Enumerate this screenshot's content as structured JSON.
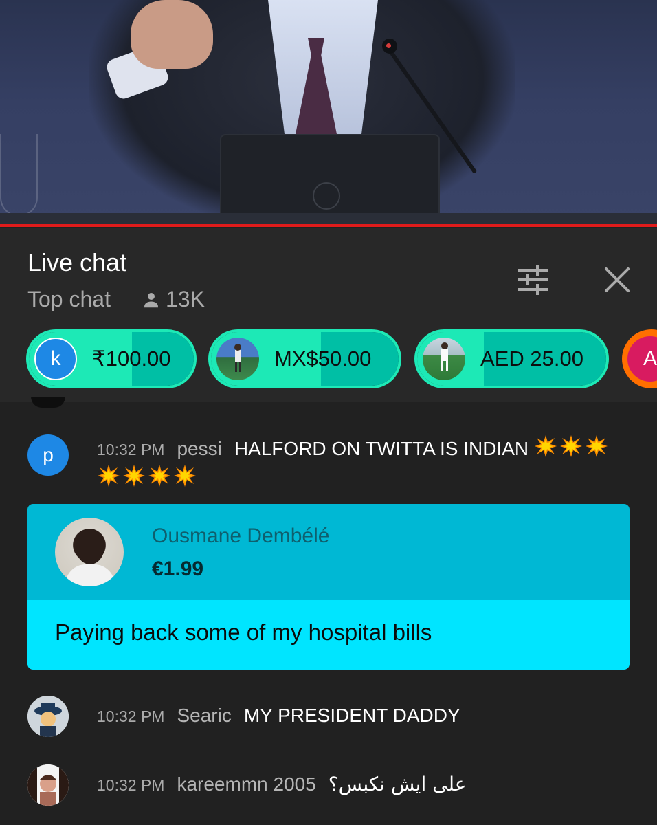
{
  "header": {
    "title": "Live chat",
    "mode": "Top chat",
    "viewer_count": "13K"
  },
  "ticker": [
    {
      "avatar_letter": "k",
      "amount": "₹100.00"
    },
    {
      "avatar_letter": "",
      "amount": "MX$50.00"
    },
    {
      "avatar_letter": "",
      "amount": "AED 25.00"
    },
    {
      "avatar_letter": "A",
      "amount": ""
    }
  ],
  "messages": [
    {
      "avatar_letter": "p",
      "time": "10:32 PM",
      "author": "pessi",
      "text": "HALFORD ON TWITTA IS INDIAN",
      "emoji": "collision",
      "emoji_count": 7
    },
    {
      "avatar_letter": "",
      "time": "10:32 PM",
      "author": "Searic",
      "text": "MY PRESIDENT DADDY"
    },
    {
      "avatar_letter": "",
      "time": "10:32 PM",
      "author": "kareemmn 2005",
      "text": "على ايش نكبس؟"
    }
  ],
  "superchat": {
    "author": "Ousmane Dembélé",
    "amount": "€1.99",
    "message": "Paying back some of my hospital bills"
  },
  "colors": {
    "ticker_green": "#1de9b6",
    "superchat_header": "#00b8d4",
    "superchat_body": "#00e5ff",
    "progress_red": "#e01b1b"
  }
}
